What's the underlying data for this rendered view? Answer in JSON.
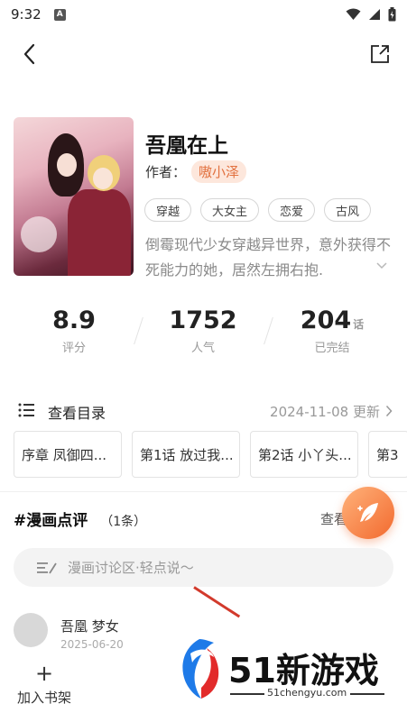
{
  "status_bar": {
    "time": "9:32",
    "badge_letter": "A"
  },
  "book": {
    "title": "吾凰在上",
    "author_label": "作者：",
    "author_name": "嗷小泽",
    "tags": [
      "穿越",
      "大女主",
      "恋爱",
      "古风"
    ],
    "description": "倒霉现代少女穿越异世界，意外获得不死能力的她，居然左拥右抱."
  },
  "stats": {
    "rating": {
      "value": "8.9",
      "label": "评分"
    },
    "popularity": {
      "value": "1752",
      "label": "人气"
    },
    "episodes": {
      "value": "204",
      "unit": "话",
      "label": "已完结"
    }
  },
  "catalog": {
    "label": "查看目录",
    "update": "2024-11-08 更新",
    "chapters": [
      "序章 凤御四...",
      "第1话 放过我...",
      "第2话 小丫头...",
      "第3"
    ]
  },
  "reviews": {
    "title": "#漫画点评",
    "count": "（1条）",
    "view_all": "查看",
    "input_placeholder": "漫画讨论区·轻点说～",
    "items": [
      {
        "user": "吾凰 梦女",
        "date": "2025-06-20"
      }
    ]
  },
  "bottom": {
    "add_shelf": "加入书架",
    "add_icon": "plus-icon"
  },
  "watermark": {
    "brand": "51新游戏",
    "url": "51chengyu.com"
  },
  "colors": {
    "accent": "#f26a2f",
    "author_tag_bg": "#fde7dc",
    "author_tag_text": "#e2713f"
  }
}
